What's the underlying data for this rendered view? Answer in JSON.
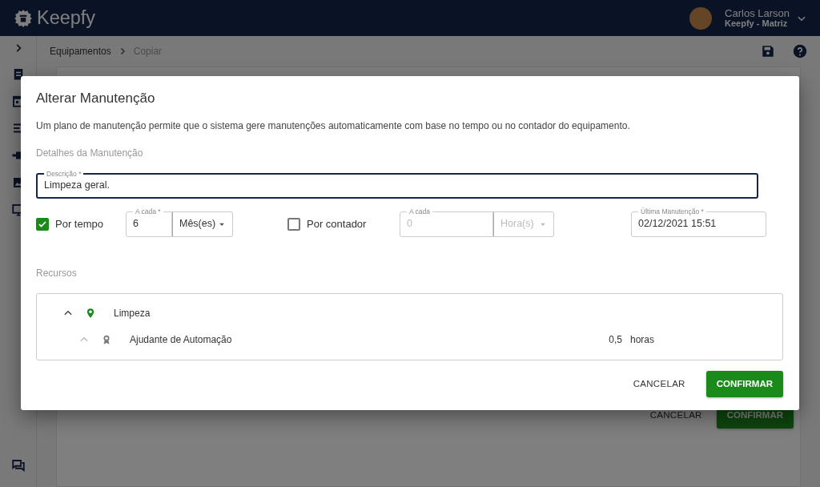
{
  "header": {
    "logo": "Keepfy",
    "user_name": "Carlos Larson",
    "user_org": "Keepfy - Matriz"
  },
  "breadcrumb": [
    {
      "label": "Equipamentos",
      "current": false
    },
    {
      "label": "Copiar",
      "current": true
    }
  ],
  "page_buttons": [
    {
      "label": "CANCELAR",
      "kind": "text"
    },
    {
      "label": "CONFIRMAR",
      "kind": "primary"
    }
  ],
  "dialog": {
    "title": "Alterar Manutenção",
    "description": "Um plano de manutenção permite que o sistema gere manutenções automaticamente com base no tempo ou no contador do equipamento.",
    "section": "Detalhes da Manutenção",
    "description_field": {
      "label": "Descrição *",
      "value": "Limpeza geral."
    },
    "triggers": [
      {
        "label": "Por tempo",
        "checked": true,
        "interval_label": "A cada *",
        "interval": "6",
        "unit": "Mês(es)"
      },
      {
        "label": "Por contador",
        "checked": false,
        "interval_label": "A cada",
        "interval": "0",
        "unit": "Hora(s)"
      }
    ],
    "last_maintenance": {
      "label": "Última Manutenção *",
      "value": "02/12/2021 15:51"
    },
    "resources_label": "Recursos",
    "resources": [
      {
        "name": "Limpeza",
        "expanded": true,
        "children": [
          {
            "name": "Ajudante de Automação",
            "quantity": "0,5",
            "unit": "horas",
            "expanded": true
          }
        ]
      }
    ],
    "buttons": [
      {
        "label": "CANCELAR",
        "kind": "text"
      },
      {
        "label": "CONFIRMAR",
        "kind": "primary"
      }
    ]
  }
}
